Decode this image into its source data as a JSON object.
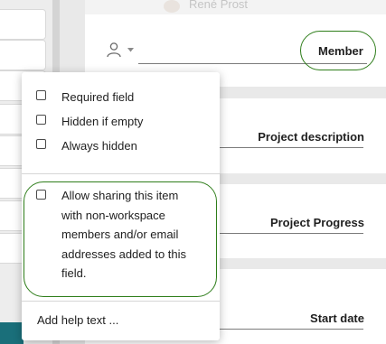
{
  "background_user": {
    "name": "René Prost"
  },
  "member_field": {
    "label": "Member",
    "icon": "person-icon"
  },
  "fields": [
    {
      "label": "Project description"
    },
    {
      "label": "Project Progress"
    },
    {
      "label": "Start date"
    }
  ],
  "menu": {
    "options": [
      {
        "label": "Required field",
        "checked": false
      },
      {
        "label": "Hidden if empty",
        "checked": false
      },
      {
        "label": "Always hidden",
        "checked": false
      }
    ],
    "share_option": {
      "label": "Allow sharing this item with non-workspace members and/or email addresses added to this field.",
      "checked": false
    },
    "help_text_link": "Add help text ..."
  },
  "colors": {
    "highlight": "#2e7d1a",
    "teal": "#1a6f7a"
  }
}
